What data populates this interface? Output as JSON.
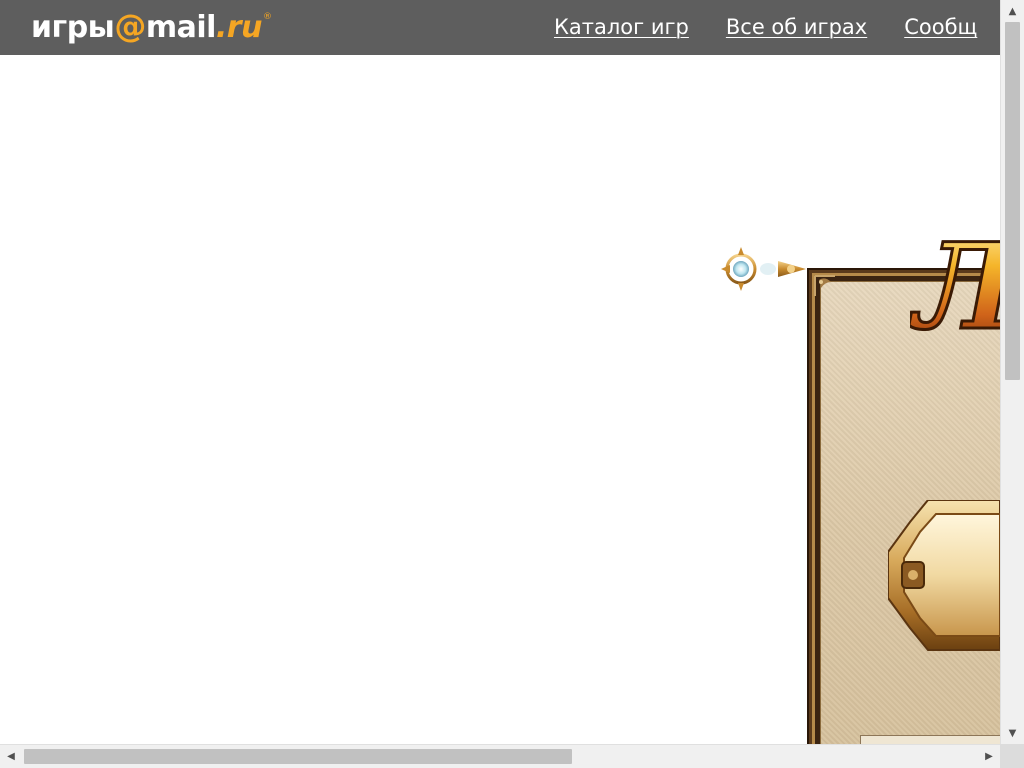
{
  "header": {
    "logo": {
      "part1": "игры",
      "at": "@",
      "part2": "mail",
      "part3": ".ru",
      "reg": "®"
    },
    "nav": [
      {
        "label": "Каталог игр"
      },
      {
        "label": "Все об играх"
      },
      {
        "label": "Сообщ"
      }
    ]
  },
  "banner": {
    "title_fragment": "Ле"
  },
  "colors": {
    "topbar_bg": "#5e5e5e",
    "logo_accent": "#f5a623",
    "parchment": "#ddc9a7",
    "frame": "#5a3a1c"
  },
  "scrollbars": {
    "vertical_up_icon": "arrow-up-icon",
    "vertical_down_icon": "arrow-down-icon",
    "horizontal_left_icon": "arrow-left-icon",
    "horizontal_right_icon": "arrow-right-icon"
  }
}
